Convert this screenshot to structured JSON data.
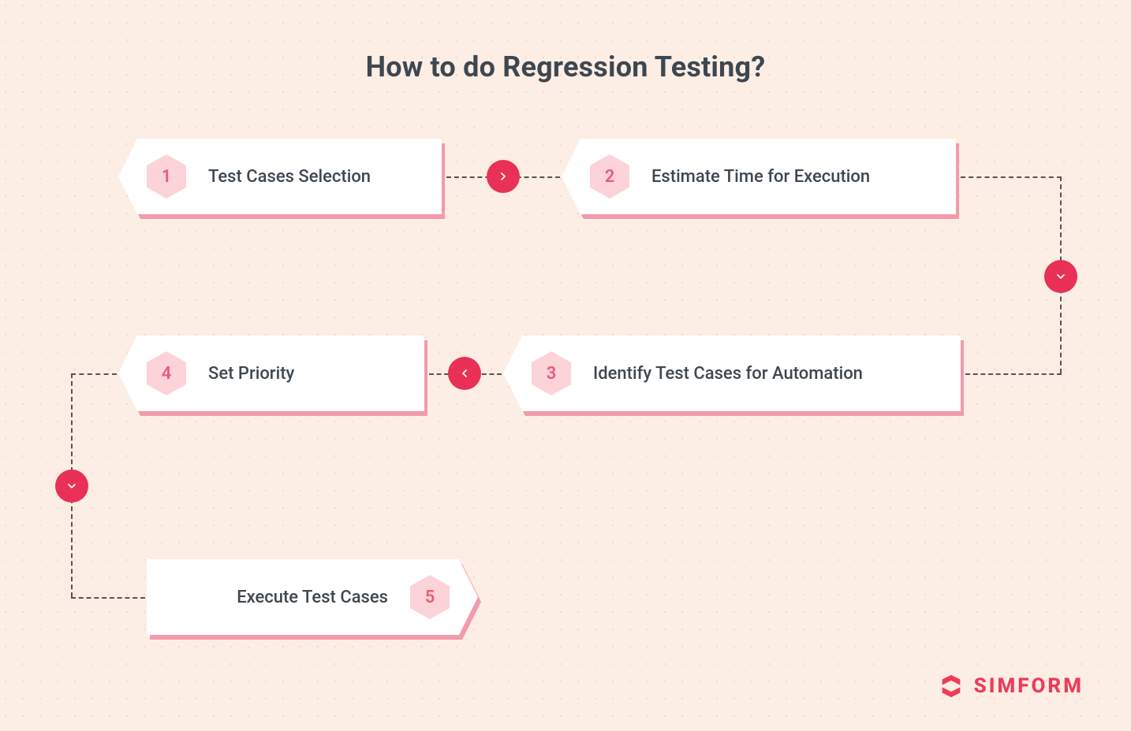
{
  "title": "How to do Regression Testing?",
  "steps": {
    "s1": {
      "num": "1",
      "label": "Test Cases Selection"
    },
    "s2": {
      "num": "2",
      "label": "Estimate Time for Execution"
    },
    "s3": {
      "num": "3",
      "label": "Identify Test Cases for Automation"
    },
    "s4": {
      "num": "4",
      "label": "Set Priority"
    },
    "s5": {
      "num": "5",
      "label": "Execute Test Cases"
    }
  },
  "brand": {
    "name": "SIMFORM"
  },
  "colors": {
    "background": "#fceee4",
    "card": "#ffffff",
    "hex_fill": "#fbd3d8",
    "hex_text": "#e95c78",
    "text": "#3e4750",
    "card_shadow": "#f39aab",
    "arrow_bg": "#e93056",
    "connector": "#555555",
    "brand": "#ee3b58"
  }
}
